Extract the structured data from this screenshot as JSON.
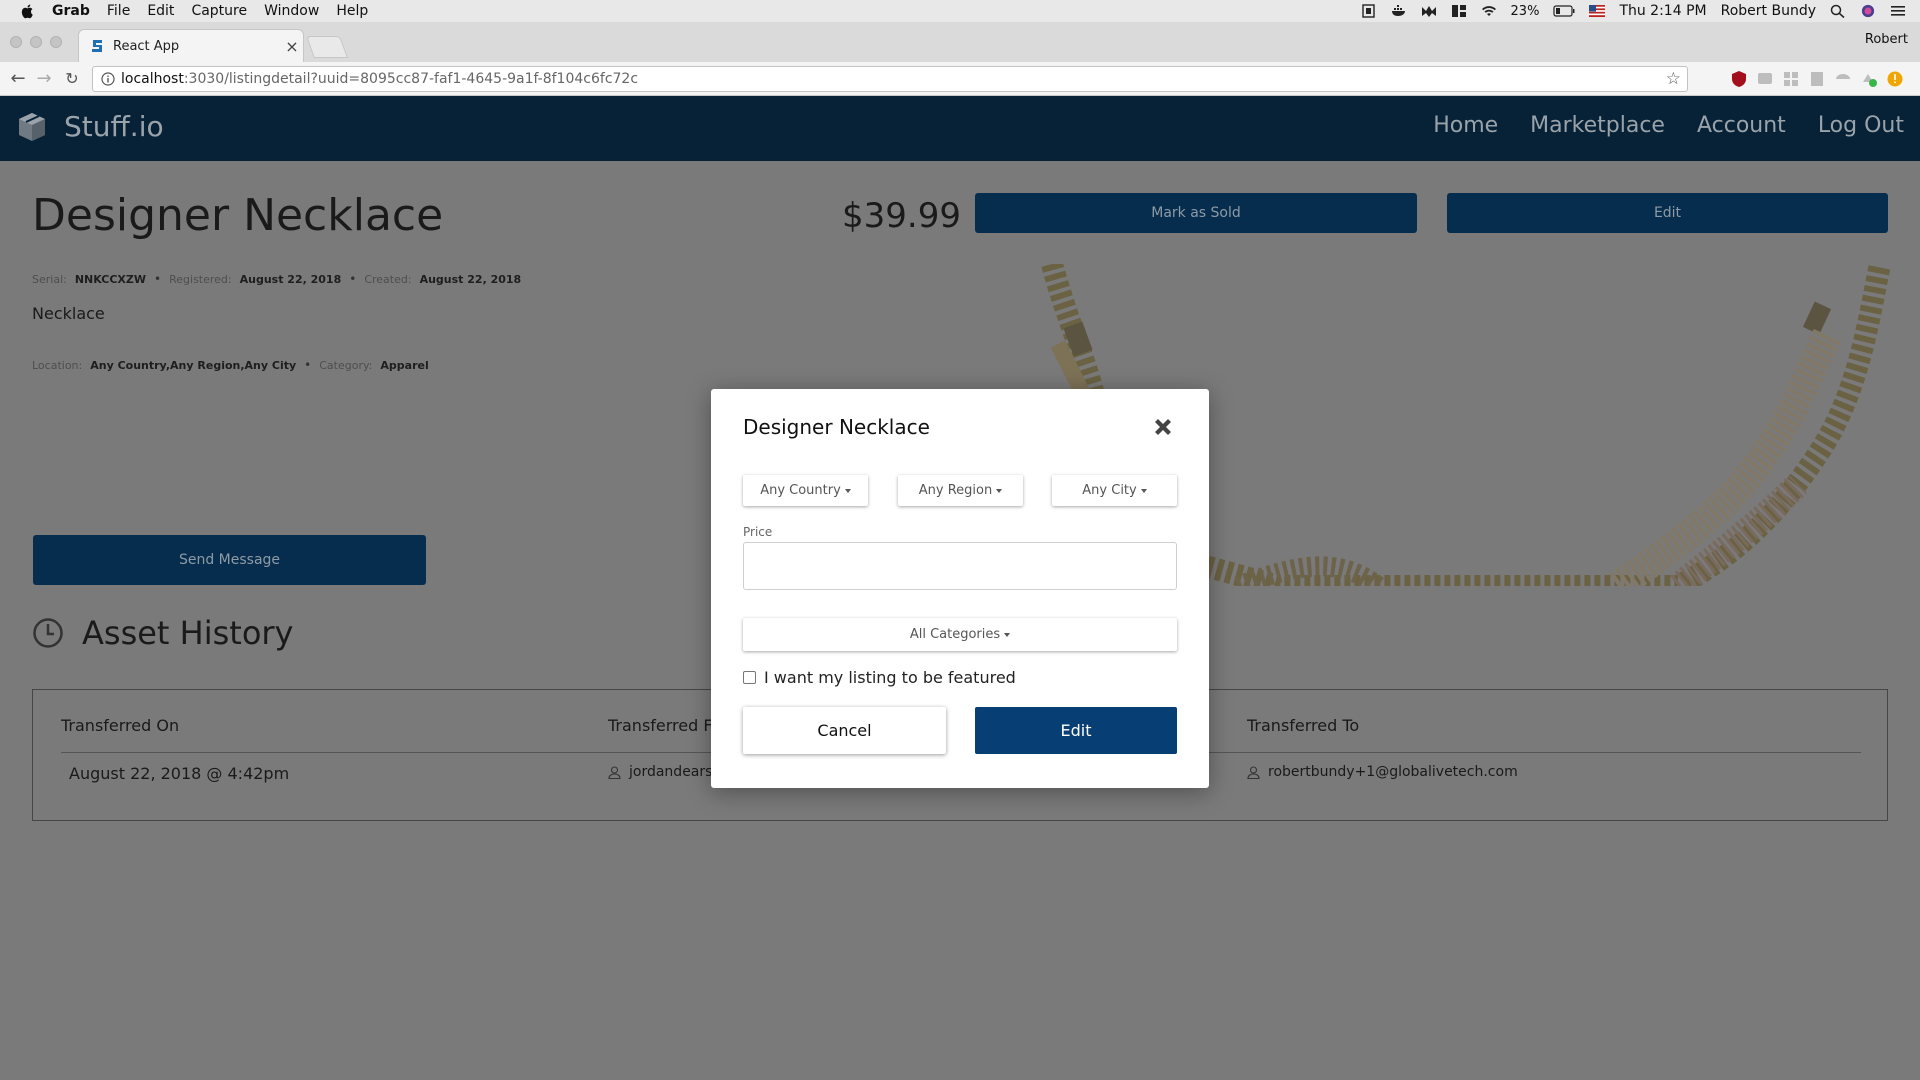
{
  "menubar": {
    "app": "Grab",
    "items": [
      "File",
      "Edit",
      "Capture",
      "Window",
      "Help"
    ],
    "battery": "23%",
    "clock": "Thu 2:14 PM",
    "user": "Robert Bundy"
  },
  "browser": {
    "tab_title": "React App",
    "tab_close": "×",
    "profile": "Robert",
    "url_host": "localhost",
    "url_path": ":3030/listingdetail?uuid=8095cc87-faf1-4645-9a1f-8f104c6fc72c"
  },
  "site": {
    "brand": "Stuff.io",
    "nav": [
      "Home",
      "Marketplace",
      "Account",
      "Log Out"
    ]
  },
  "listing": {
    "title": "Designer Necklace",
    "price": "$39.99",
    "mark_sold_label": "Mark as Sold",
    "edit_label": "Edit",
    "serial_label": "Serial:",
    "serial": "NNKCCXZW",
    "registered_label": "Registered:",
    "registered": "August 22, 2018",
    "created_label": "Created:",
    "created": "August 22, 2018",
    "subcategory": "Necklace",
    "location_label": "Location:",
    "location": "Any Country,Any Region,Any City",
    "category_label": "Category:",
    "category": "Apparel",
    "send_message_label": "Send Message"
  },
  "history": {
    "title": "Asset History",
    "headers": [
      "Transferred On",
      "Transferred F",
      "Transferred To"
    ],
    "rows": [
      {
        "on": "August 22, 2018 @ 4:42pm",
        "from": "jordandears",
        "to": "robertbundy+1@globalivetech.com"
      }
    ]
  },
  "modal": {
    "title": "Designer Necklace",
    "country": "Any Country",
    "region": "Any Region",
    "city": "Any City",
    "price_label": "Price",
    "price_value": "",
    "category": "All Categories",
    "featured_label": "I want my listing to be featured",
    "cancel_label": "Cancel",
    "edit_label": "Edit"
  }
}
